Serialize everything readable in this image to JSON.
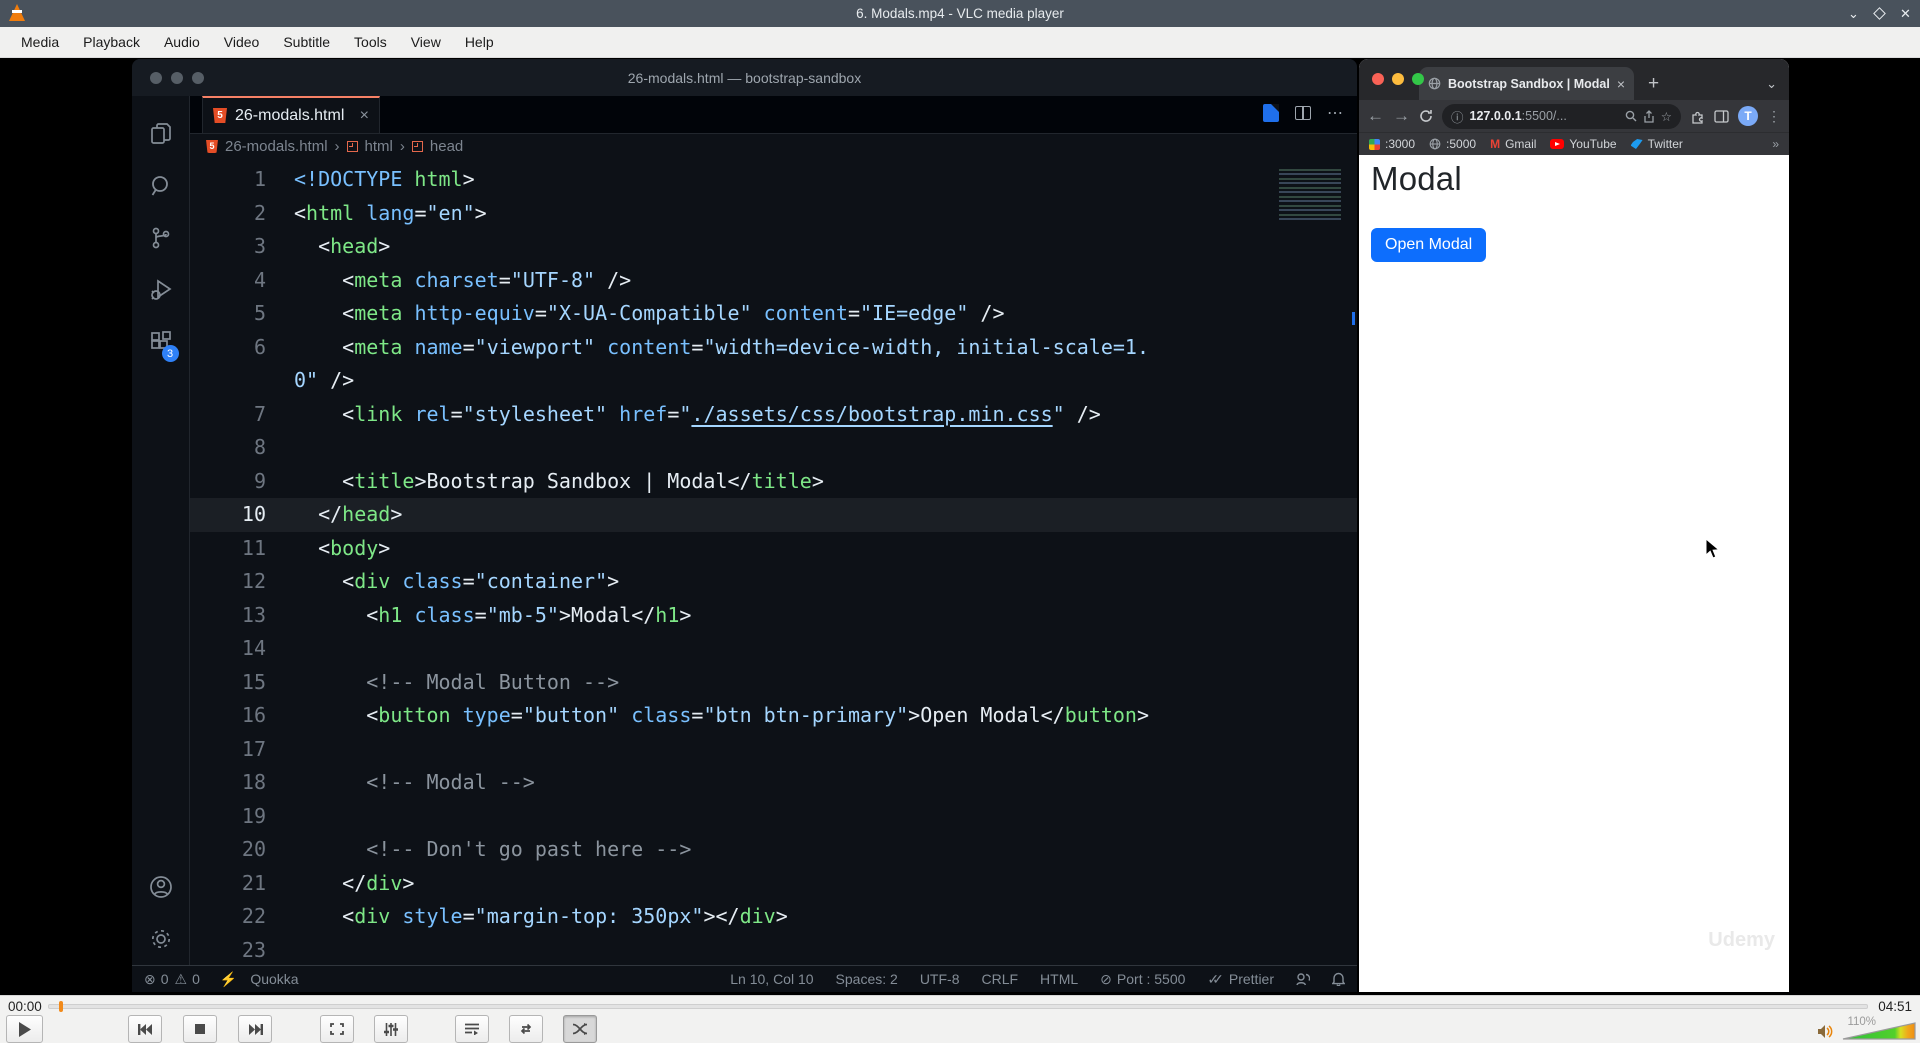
{
  "vlc": {
    "title": "6. Modals.mp4 - VLC media player",
    "menu": [
      "Media",
      "Playback",
      "Audio",
      "Video",
      "Subtitle",
      "Tools",
      "View",
      "Help"
    ],
    "time_elapsed": "00:00",
    "time_total": "04:51",
    "volume_label": "110%"
  },
  "vscode": {
    "window_title": "26-modals.html — bootstrap-sandbox",
    "tab_label": "26-modals.html",
    "tab_close": "×",
    "html5_glyph": "5",
    "breadcrumb": [
      "26-modals.html",
      "html",
      "head"
    ],
    "extensions_badge": "3",
    "status": {
      "errors": "0",
      "warnings": "0",
      "quokka": "Quokka",
      "cursor_pos": "Ln 10, Col 10",
      "indent": "Spaces: 2",
      "encoding": "UTF-8",
      "eol": "CRLF",
      "language": "HTML",
      "port": "Port : 5500",
      "formatter": "Prettier"
    },
    "code": {
      "tab_accent_color": "#f78166",
      "lines": [
        {
          "n": "1",
          "t": [
            [
              "at",
              "<!DOCTYPE"
            ],
            [
              "tx",
              " "
            ],
            [
              "tg",
              "html"
            ],
            [
              "tx",
              ">"
            ]
          ]
        },
        {
          "n": "2",
          "t": [
            [
              "tx",
              "<"
            ],
            [
              "tg",
              "html"
            ],
            [
              "tx",
              " "
            ],
            [
              "at",
              "lang"
            ],
            [
              "tx",
              "="
            ],
            [
              "st",
              "\"en\""
            ],
            [
              "tx",
              ">"
            ]
          ]
        },
        {
          "n": "3",
          "t": [
            [
              "tx",
              "  <"
            ],
            [
              "tg",
              "head"
            ],
            [
              "tx",
              ">"
            ]
          ]
        },
        {
          "n": "4",
          "t": [
            [
              "tx",
              "    <"
            ],
            [
              "tg",
              "meta"
            ],
            [
              "tx",
              " "
            ],
            [
              "at",
              "charset"
            ],
            [
              "tx",
              "="
            ],
            [
              "st",
              "\"UTF-8\""
            ],
            [
              "tx",
              " />"
            ]
          ]
        },
        {
          "n": "5",
          "t": [
            [
              "tx",
              "    <"
            ],
            [
              "tg",
              "meta"
            ],
            [
              "tx",
              " "
            ],
            [
              "at",
              "http-equiv"
            ],
            [
              "tx",
              "="
            ],
            [
              "st",
              "\"X-UA-Compatible\""
            ],
            [
              "tx",
              " "
            ],
            [
              "at",
              "content"
            ],
            [
              "tx",
              "="
            ],
            [
              "st",
              "\"IE=edge\""
            ],
            [
              "tx",
              " />"
            ]
          ]
        },
        {
          "n": "6",
          "t": [
            [
              "tx",
              "    <"
            ],
            [
              "tg",
              "meta"
            ],
            [
              "tx",
              " "
            ],
            [
              "at",
              "name"
            ],
            [
              "tx",
              "="
            ],
            [
              "st",
              "\"viewport\""
            ],
            [
              "tx",
              " "
            ],
            [
              "at",
              "content"
            ],
            [
              "tx",
              "="
            ],
            [
              "st",
              "\"width=device-width, initial-scale=1."
            ]
          ]
        },
        {
          "n": "",
          "t": [
            [
              "st",
              "0\""
            ],
            [
              "tx",
              " />"
            ]
          ]
        },
        {
          "n": "7",
          "t": [
            [
              "tx",
              "    <"
            ],
            [
              "tg",
              "link"
            ],
            [
              "tx",
              " "
            ],
            [
              "at",
              "rel"
            ],
            [
              "tx",
              "="
            ],
            [
              "st",
              "\"stylesheet\""
            ],
            [
              "tx",
              " "
            ],
            [
              "at",
              "href"
            ],
            [
              "tx",
              "="
            ],
            [
              "st",
              "\""
            ],
            [
              "lk",
              "./assets/css/bootstrap.min.css"
            ],
            [
              "st",
              "\""
            ],
            [
              "tx",
              " />"
            ]
          ]
        },
        {
          "n": "8",
          "t": []
        },
        {
          "n": "9",
          "t": [
            [
              "tx",
              "    <"
            ],
            [
              "tg",
              "title"
            ],
            [
              "tx",
              ">Bootstrap Sandbox | Modal</"
            ],
            [
              "tg",
              "title"
            ],
            [
              "tx",
              ">"
            ]
          ]
        },
        {
          "n": "10",
          "cur": true,
          "t": [
            [
              "tx",
              "  </"
            ],
            [
              "tg",
              "head"
            ],
            [
              "tx",
              ">"
            ]
          ]
        },
        {
          "n": "11",
          "t": [
            [
              "tx",
              "  <"
            ],
            [
              "tg",
              "body"
            ],
            [
              "tx",
              ">"
            ]
          ]
        },
        {
          "n": "12",
          "t": [
            [
              "tx",
              "    <"
            ],
            [
              "tg",
              "div"
            ],
            [
              "tx",
              " "
            ],
            [
              "at",
              "class"
            ],
            [
              "tx",
              "="
            ],
            [
              "st",
              "\"container\""
            ],
            [
              "tx",
              ">"
            ]
          ]
        },
        {
          "n": "13",
          "t": [
            [
              "tx",
              "      <"
            ],
            [
              "tg",
              "h1"
            ],
            [
              "tx",
              " "
            ],
            [
              "at",
              "class"
            ],
            [
              "tx",
              "="
            ],
            [
              "st",
              "\"mb-5\""
            ],
            [
              "tx",
              ">Modal</"
            ],
            [
              "tg",
              "h1"
            ],
            [
              "tx",
              ">"
            ]
          ]
        },
        {
          "n": "14",
          "t": []
        },
        {
          "n": "15",
          "t": [
            [
              "cm",
              "      <!-- Modal Button -->"
            ]
          ]
        },
        {
          "n": "16",
          "t": [
            [
              "tx",
              "      <"
            ],
            [
              "tg",
              "button"
            ],
            [
              "tx",
              " "
            ],
            [
              "at",
              "type"
            ],
            [
              "tx",
              "="
            ],
            [
              "st",
              "\"button\""
            ],
            [
              "tx",
              " "
            ],
            [
              "at",
              "class"
            ],
            [
              "tx",
              "="
            ],
            [
              "st",
              "\"btn btn-primary\""
            ],
            [
              "tx",
              ">Open Modal</"
            ],
            [
              "tg",
              "button"
            ],
            [
              "tx",
              ">"
            ]
          ]
        },
        {
          "n": "17",
          "t": []
        },
        {
          "n": "18",
          "t": [
            [
              "cm",
              "      <!-- Modal -->"
            ]
          ]
        },
        {
          "n": "19",
          "t": []
        },
        {
          "n": "20",
          "t": [
            [
              "cm",
              "      <!-- Don't go past here -->"
            ]
          ]
        },
        {
          "n": "21",
          "t": [
            [
              "tx",
              "    </"
            ],
            [
              "tg",
              "div"
            ],
            [
              "tx",
              ">"
            ]
          ]
        },
        {
          "n": "22",
          "t": [
            [
              "tx",
              "    <"
            ],
            [
              "tg",
              "div"
            ],
            [
              "tx",
              " "
            ],
            [
              "at",
              "style"
            ],
            [
              "tx",
              "="
            ],
            [
              "st",
              "\"margin-top: 350px\""
            ],
            [
              "tx",
              ">"
            ],
            [
              "tx",
              "</"
            ],
            [
              "tg",
              "div"
            ],
            [
              "tx",
              ">"
            ]
          ]
        },
        {
          "n": "23",
          "t": []
        }
      ]
    }
  },
  "chrome": {
    "tab_title": "Bootstrap Sandbox | Modal",
    "tab_close": "×",
    "url_host": "127.0.0.1",
    "url_rest": ":5500/...",
    "bookmarks": [
      ":3000",
      ":5000",
      "Gmail",
      "YouTube",
      "Twitter"
    ],
    "avatar_letter": "T",
    "accent_color": "#0d6efd",
    "page": {
      "heading": "Modal",
      "button_label": "Open Modal",
      "watermark": "Udemy"
    }
  }
}
